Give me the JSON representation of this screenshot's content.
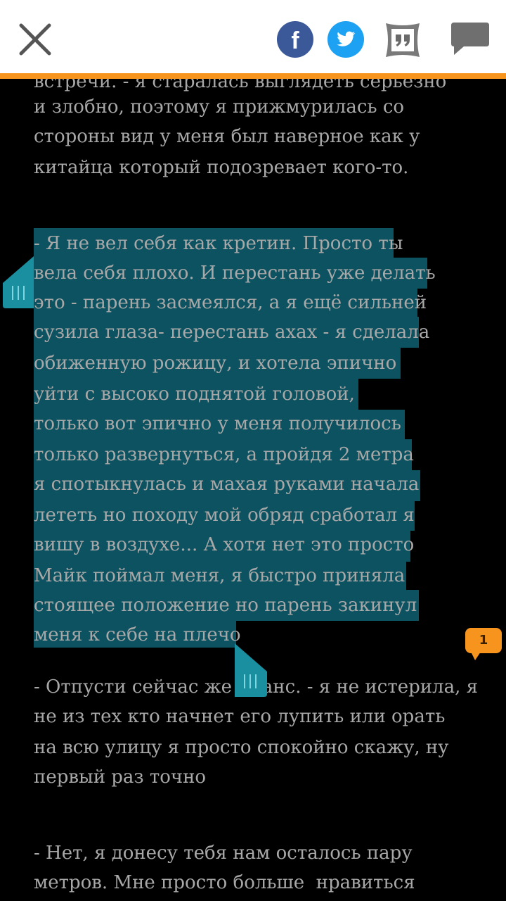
{
  "toolbar": {
    "close_icon": "close-icon",
    "facebook_icon": "facebook-icon",
    "twitter_icon": "twitter-icon",
    "quote_icon": "quote-icon",
    "comments_icon": "comments-icon",
    "accent_color": "#f7941d",
    "facebook_letter": "f"
  },
  "reader": {
    "background_color": "#000000",
    "text_color": "#a8a8a8",
    "highlight_color": "#0d5260",
    "selection_handle_color": "#1a8fa0",
    "lines_before": [
      "встречи. - я старалась выглядеть серьезно",
      "и злобно, поэтому я прижмурилась со",
      "стороны вид у меня был наверное как у",
      "китайца который подозревает кого-то."
    ],
    "selected_lines": [
      "- Я не вел себя как кретин. Просто ты",
      "вела себя плохо. И перестань уже делать",
      "это - парень засмеялся, а я ещё сильней",
      "сузила глаза- перестань ахах - я сделала",
      "обиженную рожицу, и хотела эпично",
      "уйти с высоко поднятой головой,",
      "только вот эпично у меня получилось",
      "только развернуться, а пройдя 2 метра",
      "я спотыкнулась и махая руками начала",
      "лететь но походу мой обряд сработал я",
      "вишу в воздухе... А хотя нет это просто",
      "Майк поймал меня, я быстро приняла",
      "стоящее положение но парень закинул",
      "меня к себе на плечо"
    ],
    "lines_after_1": [
      "- Отпусти сейчас же Эванс. - я не истерила, я",
      "не из тех кто начнет его лупить или орать",
      "на всю улицу я просто спокойно скажу, ну",
      "первый раз точно"
    ],
    "lines_after_2": [
      "- Нет, я донесу тебя нам осталось пару",
      "метров. Мне просто больше  нравиться"
    ],
    "note_count": "1"
  }
}
